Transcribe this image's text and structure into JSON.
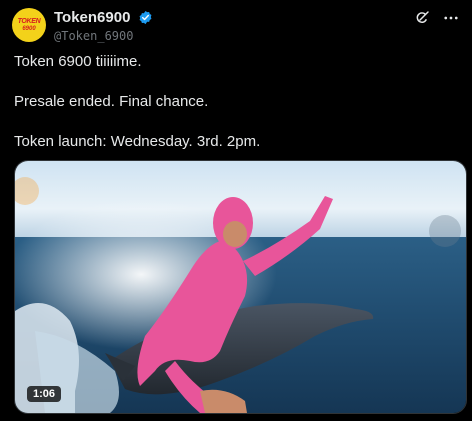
{
  "author": {
    "display_name": "Token6900",
    "handle": "@Token_6900",
    "avatar_text_top": "TOKEN",
    "avatar_text_bottom": "6900",
    "verified": true
  },
  "post": {
    "lines": [
      "Token 6900 tiiiiime.",
      "Presale ended. Final chance.",
      "Token launch: Wednesday. 3rd. 2pm."
    ]
  },
  "media": {
    "type": "video",
    "duration": "1:06"
  },
  "icons": {
    "grok": "grok-icon",
    "more": "more-icon",
    "verified": "verified-badge-icon"
  },
  "colors": {
    "background": "#000000",
    "text": "#e7e9ea",
    "muted": "#71767b",
    "verified": "#1d9bf0",
    "avatar_bg": "#f3d21a"
  }
}
